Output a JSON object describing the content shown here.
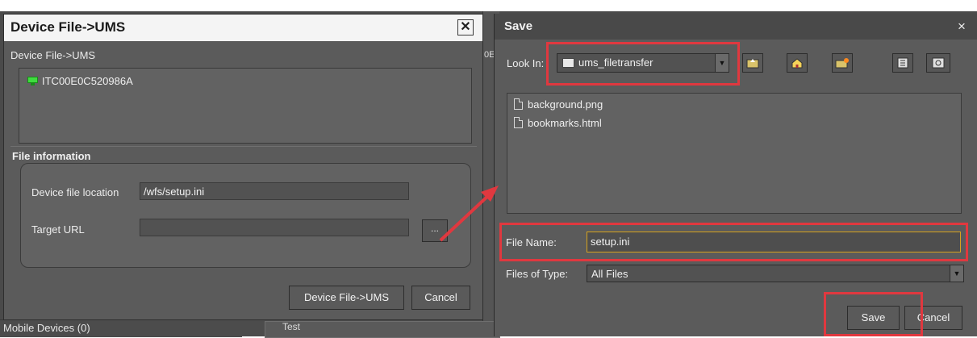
{
  "left_dialog": {
    "title": "Device File->UMS",
    "section_label": "Device File->UMS",
    "device_name": "ITC00E0C520986A",
    "file_info_title": "File information",
    "device_file_location_label": "Device file location",
    "device_file_location_value": "/wfs/setup.ini",
    "target_url_label": "Target URL",
    "target_url_value": "",
    "browse_label": "...",
    "ok_button": "Device File->UMS",
    "cancel_button": "Cancel"
  },
  "background": {
    "mobile_devices": "Mobile Devices (0)",
    "test_label": "Test",
    "partial_tab": "0E"
  },
  "save_dialog": {
    "title": "Save",
    "close_label": "×",
    "look_in_label": "Look In:",
    "look_in_value": "ums_filetransfer",
    "files": [
      "background.png",
      "bookmarks.html"
    ],
    "file_name_label": "File Name:",
    "file_name_value": "setup.ini",
    "files_of_type_label": "Files of Type:",
    "files_of_type_value": "All Files",
    "save_button": "Save",
    "cancel_button": "Cancel"
  },
  "colors": {
    "highlight": "#e0383f",
    "dialog_bg": "#5b5b5b",
    "file_name_border": "#d6a21e"
  }
}
